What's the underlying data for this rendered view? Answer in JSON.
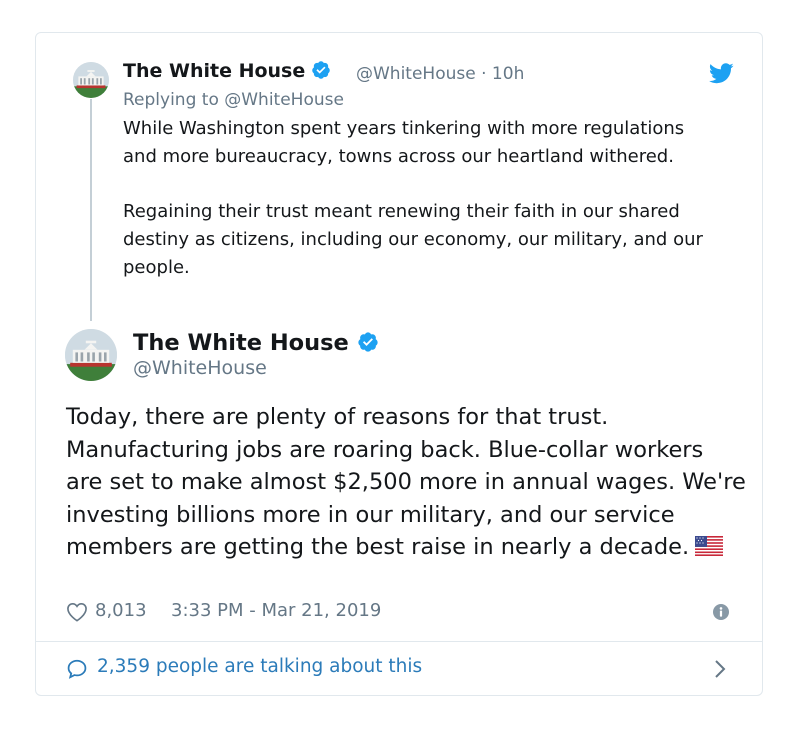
{
  "reply_tweet": {
    "author_name": "The White House",
    "handle": "@WhiteHouse",
    "time_ago": "· 10h",
    "replying_to": "Replying to @WhiteHouse",
    "paragraphs": [
      "While Washington spent years tinkering with more regulations and more bureaucracy, towns across our heartland withered.",
      "Regaining their trust meant renewing their faith in our shared destiny as citizens, including our economy, our military, and our people."
    ]
  },
  "main_tweet": {
    "author_name": "The White House",
    "handle": "@WhiteHouse",
    "text": "Today, there are plenty of reasons for that trust. Manufacturing jobs are roaring back. Blue-collar workers are set to make almost $2,500 more in annual wages. We're investing billions more in our military, and our service members are getting the best raise in nearly a decade.",
    "likes": "8,013",
    "timestamp": "3:33 PM - Mar 21, 2019"
  },
  "footer": {
    "talking": "2,359 people are talking about this"
  },
  "icons": {
    "verified": "verified-badge-icon",
    "twitter": "twitter-bird-icon",
    "heart": "heart-icon",
    "info": "info-icon",
    "comment": "speech-bubble-icon",
    "chevron": "chevron-right-icon",
    "flag": "us-flag-emoji"
  },
  "colors": {
    "accent": "#1da1f2",
    "link": "#2b7bb9",
    "muted": "#657786",
    "text": "#14171a",
    "border": "#e1e8ed"
  }
}
